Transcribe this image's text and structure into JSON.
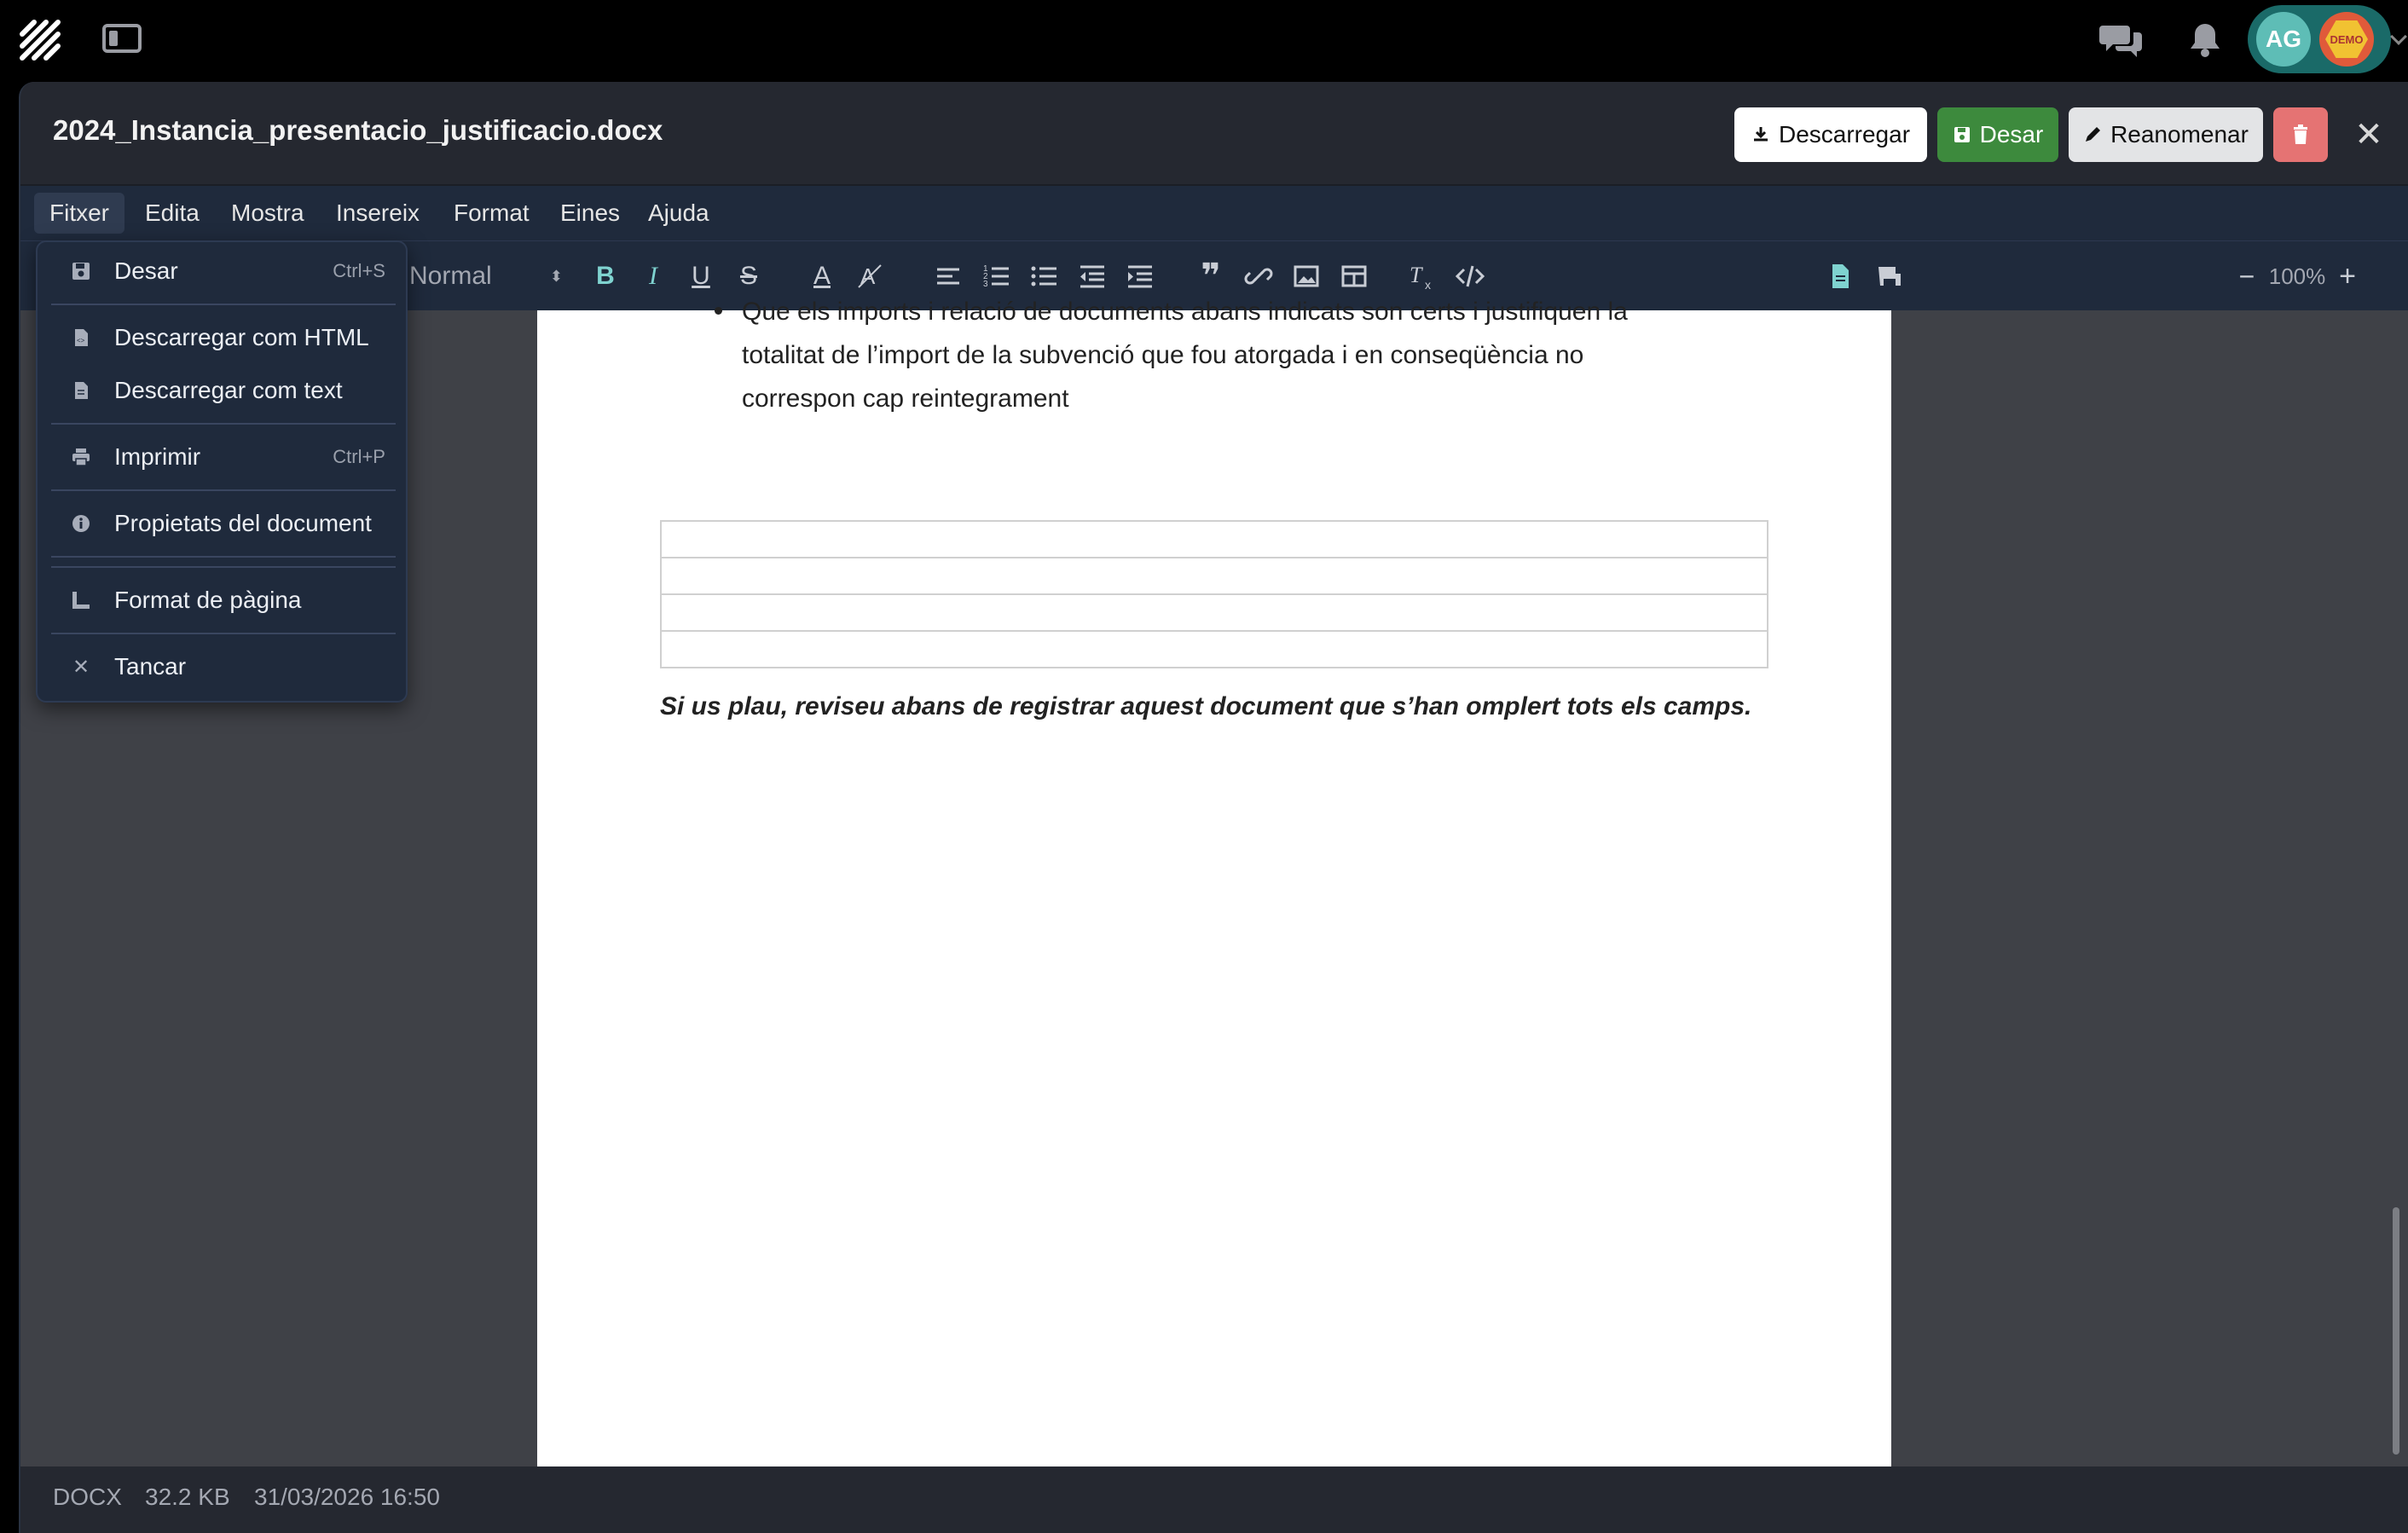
{
  "app": {
    "avatar_initials": "AG",
    "demo_badge": "DEMO"
  },
  "document": {
    "title": "2024_Instancia_presentacio_justificacio.docx",
    "body_line_1": "Que els imports i relació de documents abans indicats son certs i justifiquen la",
    "body_line_2": "totalitat de l’import de la subvenció que fou atorgada i en conseqüència no",
    "body_line_3": "correspon cap reintegrament",
    "table_rows": 4,
    "review_note": "Si us plau, reviseu abans de registrar aquest document que s’han omplert tots els camps."
  },
  "header_buttons": {
    "download": "Descarregar",
    "save": "Desar",
    "rename": "Reanomenar"
  },
  "menubar": {
    "file": "Fitxer",
    "edit": "Edita",
    "view": "Mostra",
    "insert": "Insereix",
    "format": "Format",
    "tools": "Eines",
    "help": "Ajuda"
  },
  "toolbar": {
    "style_value": "Normal",
    "zoom": "100%"
  },
  "file_menu": {
    "save": "Desar",
    "save_shortcut": "Ctrl+S",
    "download_html": "Descarregar com HTML",
    "download_text": "Descarregar com text",
    "print": "Imprimir",
    "print_shortcut": "Ctrl+P",
    "properties": "Propietats del document",
    "page_format": "Format de pàgina",
    "close": "Tancar"
  },
  "status": {
    "type": "DOCX",
    "size": "32.2 KB",
    "modified": "31/03/2026 16:50"
  },
  "colors": {
    "save_green": "#3d8a3d",
    "delete_red": "#e57373",
    "toolbar_bg": "#1f2a3c",
    "accent_teal": "#5ebdb6"
  }
}
